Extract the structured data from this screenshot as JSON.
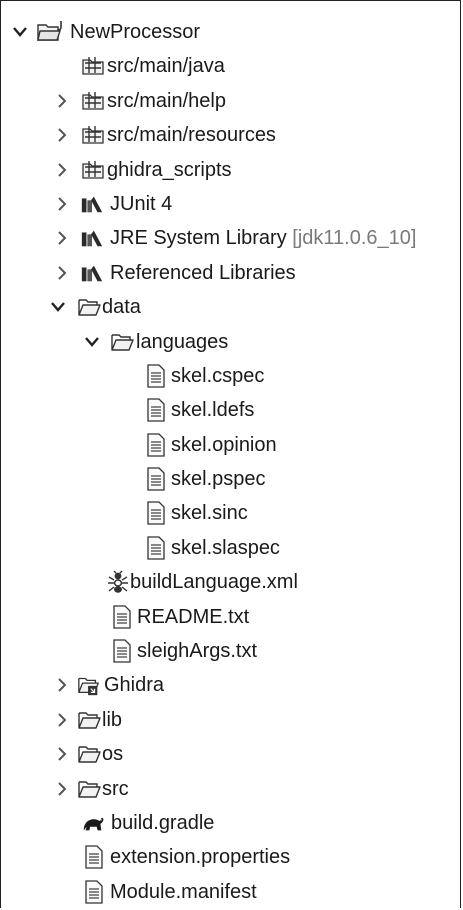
{
  "tree": {
    "root": {
      "label": "NewProcessor",
      "expanded": true,
      "icon": "java-project-icon"
    },
    "items": [
      {
        "label": "src/main/java",
        "icon": "source-folder-icon"
      },
      {
        "label": "src/main/help",
        "icon": "source-folder-icon",
        "collapsed": true
      },
      {
        "label": "src/main/resources",
        "icon": "source-folder-icon",
        "collapsed": true
      },
      {
        "label": "ghidra_scripts",
        "icon": "source-folder-icon",
        "collapsed": true
      },
      {
        "label": "JUnit 4",
        "icon": "library-icon",
        "collapsed": true
      },
      {
        "label": "JRE System Library",
        "suffix": "[jdk11.0.6_10]",
        "icon": "library-icon",
        "collapsed": true
      },
      {
        "label": "Referenced Libraries",
        "icon": "library-icon",
        "collapsed": true
      },
      {
        "label": "data",
        "icon": "folder-open-icon",
        "expanded": true
      },
      {
        "label": "languages",
        "icon": "folder-open-icon",
        "expanded": true
      },
      {
        "label": "skel.cspec",
        "icon": "file-icon"
      },
      {
        "label": "skel.ldefs",
        "icon": "file-icon"
      },
      {
        "label": "skel.opinion",
        "icon": "file-icon"
      },
      {
        "label": "skel.pspec",
        "icon": "file-icon"
      },
      {
        "label": "skel.sinc",
        "icon": "file-icon"
      },
      {
        "label": "skel.slaspec",
        "icon": "file-icon"
      },
      {
        "label": "buildLanguage.xml",
        "icon": "ant-file-icon"
      },
      {
        "label": "README.txt",
        "icon": "file-icon"
      },
      {
        "label": "sleighArgs.txt",
        "icon": "file-icon"
      },
      {
        "label": "Ghidra",
        "icon": "linked-folder-icon",
        "collapsed": true
      },
      {
        "label": "lib",
        "icon": "folder-icon",
        "collapsed": true
      },
      {
        "label": "os",
        "icon": "folder-icon",
        "collapsed": true
      },
      {
        "label": "src",
        "icon": "folder-icon",
        "collapsed": true
      },
      {
        "label": "build.gradle",
        "icon": "gradle-icon"
      },
      {
        "label": "extension.properties",
        "icon": "file-icon"
      },
      {
        "label": "Module.manifest",
        "icon": "file-icon"
      }
    ]
  }
}
